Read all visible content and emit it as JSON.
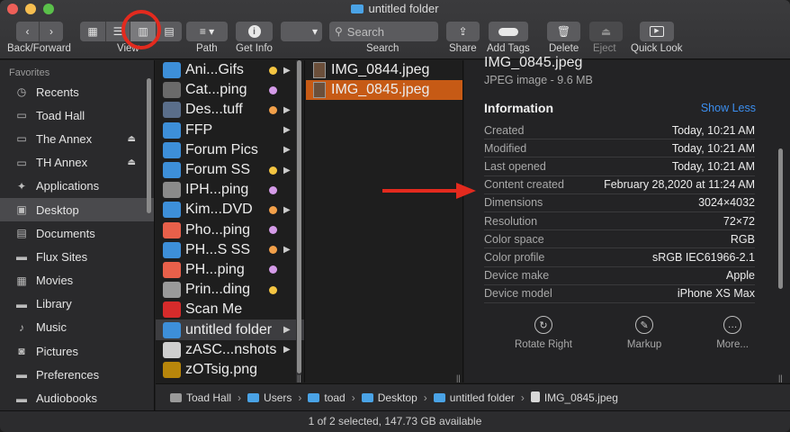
{
  "window": {
    "title": "untitled folder",
    "traffic_lights": [
      "#ee5f58",
      "#f6be50",
      "#5ac04a"
    ]
  },
  "toolbar": {
    "back_forward_label": "Back/Forward",
    "view_label": "View",
    "path_label": "Path",
    "get_info_label": "Get Info",
    "search_placeholder": "Search",
    "search_label": "Search",
    "share_label": "Share",
    "add_tags_label": "Add Tags",
    "delete_label": "Delete",
    "eject_label": "Eject",
    "quick_look_label": "Quick Look"
  },
  "sidebar": {
    "header": "Favorites",
    "items": [
      {
        "label": "Recents",
        "icon": "clock-icon"
      },
      {
        "label": "Toad Hall",
        "icon": "computer-icon"
      },
      {
        "label": "The Annex",
        "icon": "disk-icon",
        "eject": true
      },
      {
        "label": "TH Annex",
        "icon": "disk-icon",
        "eject": true
      },
      {
        "label": "Applications",
        "icon": "applications-icon"
      },
      {
        "label": "Desktop",
        "icon": "desktop-icon",
        "selected": true
      },
      {
        "label": "Documents",
        "icon": "document-icon"
      },
      {
        "label": "Flux Sites",
        "icon": "folder-icon"
      },
      {
        "label": "Movies",
        "icon": "film-icon"
      },
      {
        "label": "Library",
        "icon": "folder-icon"
      },
      {
        "label": "Music",
        "icon": "music-icon"
      },
      {
        "label": "Pictures",
        "icon": "camera-icon"
      },
      {
        "label": "Preferences",
        "icon": "folder-icon"
      },
      {
        "label": "Audiobooks",
        "icon": "folder-icon"
      }
    ]
  },
  "column1": {
    "items": [
      {
        "label": "Ani...Gifs",
        "icon_color": "#3d8fd9",
        "tag": "#f4c542",
        "arrow": true
      },
      {
        "label": "Cat...ping",
        "icon_color": "#6a6a6a",
        "tag": "#d59be8",
        "arrow": false
      },
      {
        "label": "Des...tuff",
        "icon_color": "#5a6e8a",
        "tag": "#f2a04a",
        "arrow": true
      },
      {
        "label": "FFP",
        "icon_color": "#3d8fd9",
        "tag": "",
        "arrow": true
      },
      {
        "label": "Forum Pics",
        "icon_color": "#3d8fd9",
        "tag": "",
        "arrow": true
      },
      {
        "label": "Forum SS",
        "icon_color": "#3d8fd9",
        "tag": "#f4c542",
        "arrow": true
      },
      {
        "label": "IPH...ping",
        "icon_color": "#8a8a8a",
        "tag": "#d59be8",
        "arrow": false
      },
      {
        "label": "Kim...DVD",
        "icon_color": "#3d8fd9",
        "tag": "#f2a04a",
        "arrow": true
      },
      {
        "label": "Pho...ping",
        "icon_color": "#e8604a",
        "tag": "#d59be8",
        "arrow": false
      },
      {
        "label": "PH...S SS",
        "icon_color": "#3d8fd9",
        "tag": "#f2a04a",
        "arrow": true
      },
      {
        "label": "PH...ping",
        "icon_color": "#e8604a",
        "tag": "#d59be8",
        "arrow": false
      },
      {
        "label": "Prin...ding",
        "icon_color": "#9a9a9a",
        "tag": "#f4c542",
        "arrow": false
      },
      {
        "label": "Scan Me",
        "icon_color": "#d62b2b",
        "tag": "",
        "arrow": false
      },
      {
        "label": "untitled folder",
        "icon_color": "#3d8fd9",
        "tag": "",
        "arrow": true,
        "selected": true
      },
      {
        "label": "zASC...nshots",
        "icon_color": "#cfcfcf",
        "tag": "",
        "arrow": true
      },
      {
        "label": "zOTsig.png",
        "icon_color": "#b8860b",
        "tag": "",
        "arrow": false
      }
    ]
  },
  "column2": {
    "items": [
      {
        "label": "IMG_0844.jpeg"
      },
      {
        "label": "IMG_0845.jpeg",
        "selected": true
      }
    ]
  },
  "preview": {
    "name": "IMG_0845.jpeg",
    "kind": "JPEG image - 9.6 MB",
    "info_header": "Information",
    "show_less": "Show Less",
    "rows": [
      {
        "k": "Created",
        "v": "Today, 10:21 AM"
      },
      {
        "k": "Modified",
        "v": "Today, 10:21 AM"
      },
      {
        "k": "Last opened",
        "v": "Today, 10:21 AM"
      },
      {
        "k": "Content created",
        "v": "February 28,2020 at 11:24 AM"
      },
      {
        "k": "Dimensions",
        "v": "3024×4032"
      },
      {
        "k": "Resolution",
        "v": "72×72"
      },
      {
        "k": "Color space",
        "v": "RGB"
      },
      {
        "k": "Color profile",
        "v": "sRGB IEC61966-2.1"
      },
      {
        "k": "Device make",
        "v": "Apple"
      },
      {
        "k": "Device model",
        "v": "iPhone XS Max"
      }
    ],
    "actions": [
      {
        "label": "Rotate Right",
        "icon": "rotate-right-icon"
      },
      {
        "label": "Markup",
        "icon": "markup-icon"
      },
      {
        "label": "More...",
        "icon": "more-icon"
      }
    ]
  },
  "pathbar": {
    "crumbs": [
      "Toad Hall",
      "Users",
      "toad",
      "Desktop",
      "untitled folder",
      "IMG_0845.jpeg"
    ]
  },
  "status": {
    "text": "1 of 2 selected, 147.73 GB available"
  }
}
